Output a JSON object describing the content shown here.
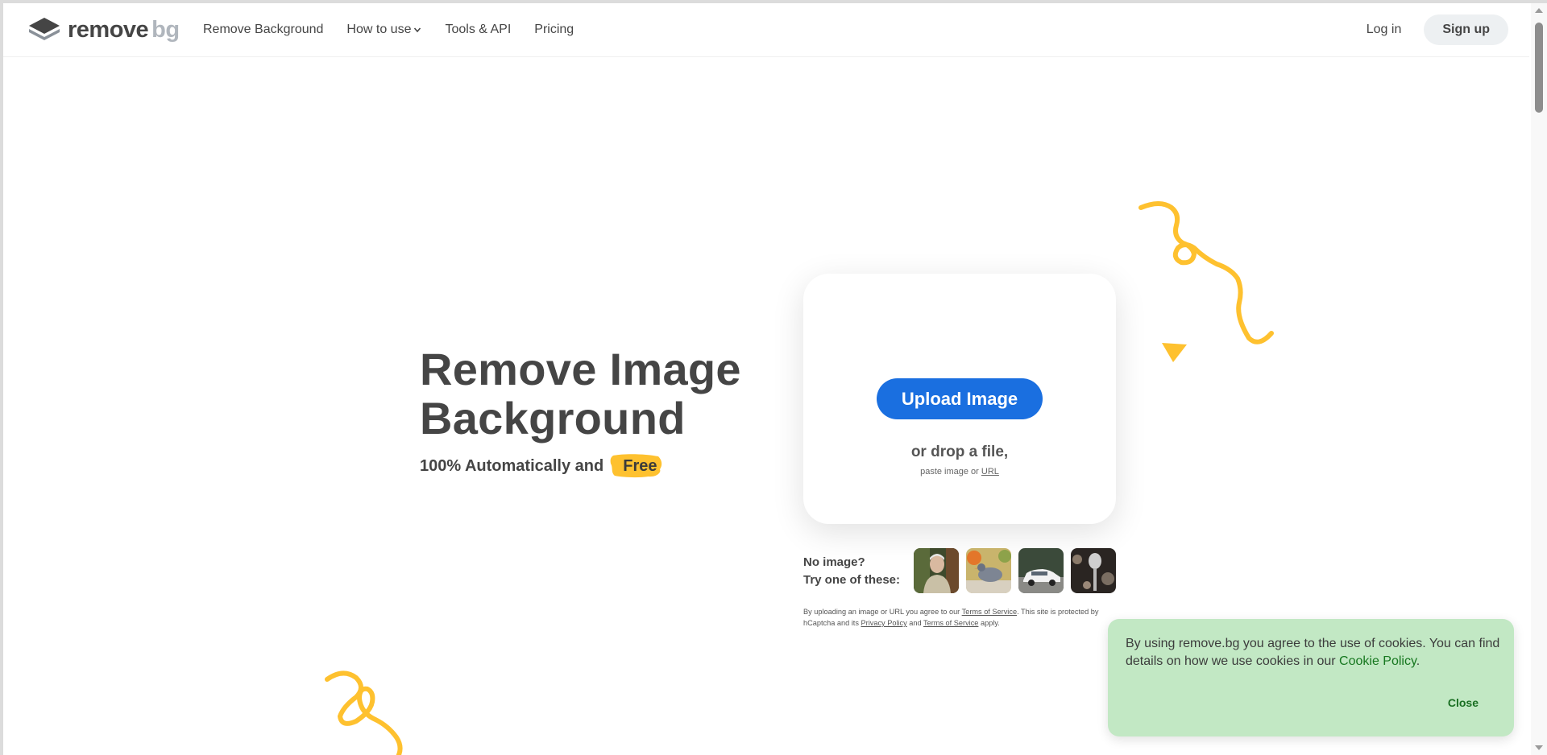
{
  "brand": {
    "name_primary": "remove",
    "name_secondary": "bg"
  },
  "nav": {
    "items": [
      {
        "label": "Remove Background"
      },
      {
        "label": "How to use",
        "icon": "chevron-down-icon"
      },
      {
        "label": "Tools & API"
      },
      {
        "label": "Pricing"
      }
    ],
    "login": "Log in",
    "signup": "Sign up"
  },
  "hero": {
    "title_line1": "Remove Image",
    "title_line2": "Background",
    "subtitle": "100% Automatically and",
    "badge": "Free"
  },
  "upload": {
    "button": "Upload Image",
    "drop": "or drop a file,",
    "paste_prefix": "paste image or",
    "url": "URL"
  },
  "samples": {
    "line1": "No image?",
    "line2": "Try one of these:",
    "thumbnails": [
      "sample-person",
      "sample-pigeon",
      "sample-car",
      "sample-microphone"
    ]
  },
  "legal": {
    "text1": "By uploading an image or URL you agree to our",
    "tos": "Terms of Service",
    "text2": ". This site is protected by hCaptcha and its",
    "privacy": "Privacy Policy",
    "and": "and",
    "tos2": "Terms of Service",
    "apply": "apply."
  },
  "cookie": {
    "text": "By using remove.bg you agree to the use of cookies. You can find details on how we use cookies in our",
    "link": "Cookie Policy",
    "period": ".",
    "close": "Close"
  },
  "colors": {
    "accent": "#1a6fe0",
    "decoration": "#fec12f",
    "cookie_bg": "#c2e8c4",
    "text": "#454545"
  }
}
